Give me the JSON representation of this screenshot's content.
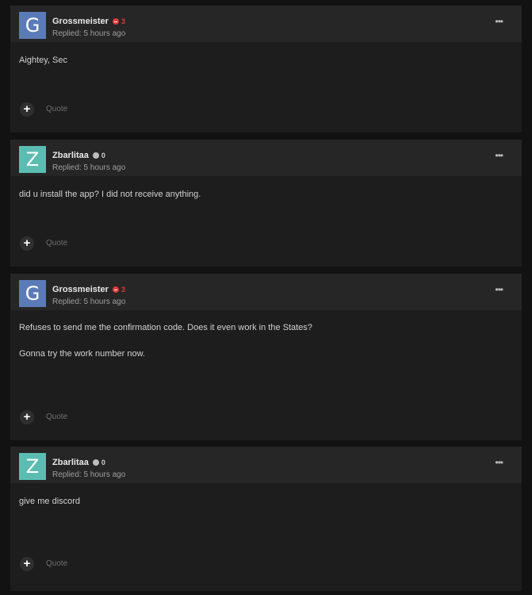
{
  "posts": [
    {
      "avatar_letter": "G",
      "avatar_color": "#5b7bb8",
      "author": "Grossmeister",
      "reputation": "3",
      "reputation_type": "negative",
      "replied": "Replied: 5 hours ago",
      "more_label": "•••",
      "paragraphs": [
        "Aightey, Sec"
      ],
      "plus_label": "+",
      "quote_label": "Quote"
    },
    {
      "avatar_letter": "Z",
      "avatar_color": "#5bbdb2",
      "author": "Zbarlitaa",
      "reputation": "0",
      "reputation_type": "neutral",
      "replied": "Replied: 5 hours ago",
      "more_label": "•••",
      "paragraphs": [
        "did u install the app? I did not receive anything."
      ],
      "plus_label": "+",
      "quote_label": "Quote"
    },
    {
      "avatar_letter": "G",
      "avatar_color": "#5b7bb8",
      "author": "Grossmeister",
      "reputation": "3",
      "reputation_type": "negative",
      "replied": "Replied: 5 hours ago",
      "more_label": "•••",
      "paragraphs": [
        "Refuses to send me the confirmation code. Does it even work in the States?",
        "Gonna try the work number now."
      ],
      "plus_label": "+",
      "quote_label": "Quote"
    },
    {
      "avatar_letter": "Z",
      "avatar_color": "#5bbdb2",
      "author": "Zbarlitaa",
      "reputation": "0",
      "reputation_type": "neutral",
      "replied": "Replied: 5 hours ago",
      "more_label": "•••",
      "paragraphs": [
        "give me discord"
      ],
      "plus_label": "+",
      "quote_label": "Quote"
    }
  ]
}
